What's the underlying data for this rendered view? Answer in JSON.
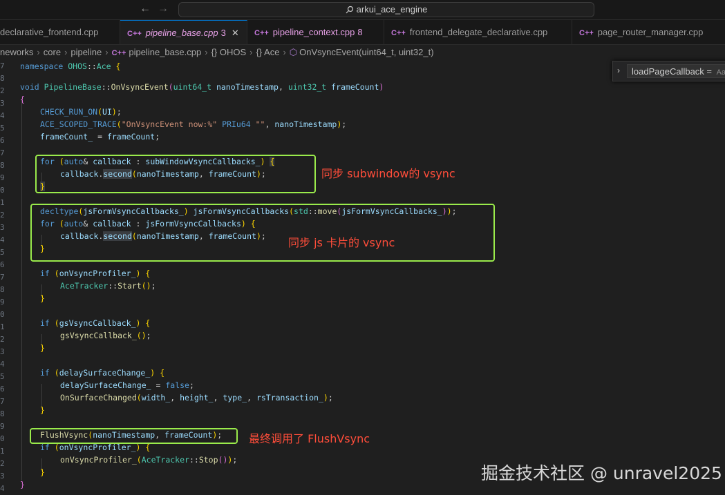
{
  "titlebar": {
    "search_text": "arkui_ace_engine"
  },
  "tabs": [
    {
      "label": "declarative_frontend.cpp",
      "icon": "cpp-icon"
    },
    {
      "label": "pipeline_base.cpp",
      "badge": "3",
      "icon": "cpp-icon",
      "active": true
    },
    {
      "label": "pipeline_context.cpp",
      "badge": "8",
      "icon": "cpp-icon"
    },
    {
      "label": "frontend_delegate_declarative.cpp",
      "icon": "cpp-icon"
    },
    {
      "label": "page_router_manager.cpp",
      "icon": "cpp-icon"
    }
  ],
  "breadcrumb": {
    "items": [
      "neworks",
      "core",
      "pipeline",
      "pipeline_base.cpp",
      "{} OHOS",
      "{} Ace",
      "OnVsyncEvent(uint64_t, uint32_t)"
    ]
  },
  "find_widget": {
    "value": "loadPageCallback = ",
    "option": "Aa"
  },
  "code": {
    "line_numbers": [
      "7",
      "8",
      "2",
      "3",
      "4",
      "5",
      "6",
      "7",
      "8",
      "9",
      "0",
      "1",
      "2",
      "3",
      "4",
      "5",
      "6",
      "7",
      "8",
      "9",
      "0",
      "1",
      "2",
      "3",
      "4",
      "5",
      "6",
      "7",
      "8",
      "9",
      "0",
      "1",
      "2",
      "3",
      "4",
      "5",
      "6"
    ],
    "ns_line": "namespace OHOS::Ace {",
    "func_sig": "void PipelineBase::OnVsyncEvent(uint64_t nanoTimestamp, uint32_t frameCount)",
    "open_brace": "{",
    "check_run": "CHECK_RUN_ON(UI);",
    "trace": "ACE_SCOPED_TRACE(\"OnVsyncEvent now:%\" PRIu64 \"\", nanoTimestamp);",
    "frame_assign": "frameCount_ = frameCount;",
    "sub_for": "for (auto& callback : subWindowVsyncCallbacks_) {",
    "sub_call": "callback.second(nanoTimestamp, frameCount);",
    "close1": "}",
    "decltype_line": "decltype(jsFormVsyncCallbacks_) jsFormVsyncCallbacks(std::move(jsFormVsyncCallbacks_));",
    "js_for": "for (auto& callback : jsFormVsyncCallbacks) {",
    "js_call": "callback.second(nanoTimestamp, frameCount);",
    "close2": "}",
    "if_profiler": "if (onVsyncProfiler_) {",
    "tracker_start": "AceTracker::Start();",
    "close3": "}",
    "if_gs": "if (gsVsyncCallback_) {",
    "gs_call": "gsVsyncCallback_();",
    "close4": "}",
    "if_delay": "if (delaySurfaceChange_) {",
    "delay_assign": "delaySurfaceChange_ = false;",
    "surface_changed": "OnSurfaceChanged(width_, height_, type_, rsTransaction_);",
    "close5": "}",
    "flush": "FlushVsync(nanoTimestamp, frameCount);",
    "if_profiler2": "if (onVsyncProfiler_) {",
    "profiler_stop": "onVsyncProfiler_(AceTracker::Stop());",
    "close6": "}",
    "close_func": "}"
  },
  "annotations": {
    "sub_note": "同步 subwindow的 vsync",
    "js_note": "同步 js 卡片的 vsync",
    "flush_note": "最终调用了 FlushVsync"
  },
  "watermark": "掘金技术社区 @ unravel2025",
  "colors": {
    "box": "#9aeb4b",
    "note": "#ff4d3a",
    "background": "#1f1f1f",
    "active_tab": "#e6a0e6"
  }
}
